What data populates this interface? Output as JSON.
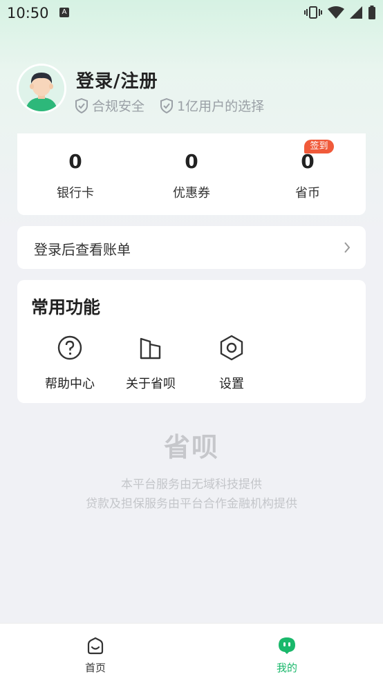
{
  "status_bar": {
    "time": "10:50",
    "notification_icon": "a-icon",
    "icons": [
      "vibrate-icon",
      "wifi-icon",
      "signal-icon",
      "battery-icon"
    ]
  },
  "profile": {
    "title": "登录/注册",
    "tags": [
      {
        "icon": "shield-check-icon",
        "label": "合规安全"
      },
      {
        "icon": "shield-check-icon",
        "label": "1亿用户的选择"
      }
    ]
  },
  "stats": [
    {
      "value": "0",
      "label": "银行卡"
    },
    {
      "value": "0",
      "label": "优惠券"
    },
    {
      "value": "0",
      "label": "省币",
      "badge": "签到"
    }
  ],
  "bill": {
    "label": "登录后查看账单"
  },
  "functions": {
    "title": "常用功能",
    "items": [
      {
        "icon": "help-icon",
        "label": "帮助中心"
      },
      {
        "icon": "building-icon",
        "label": "关于省呗"
      },
      {
        "icon": "settings-icon",
        "label": "设置"
      }
    ]
  },
  "footer": {
    "logo": "省呗",
    "line1": "本平台服务由无域科技提供",
    "line2": "贷款及担保服务由平台合作金融机构提供"
  },
  "tabbar": {
    "items": [
      {
        "label": "首页",
        "active": false
      },
      {
        "label": "我的",
        "active": true
      }
    ]
  },
  "colors": {
    "accent": "#1ab86b",
    "badge": "#f05a3a",
    "background": "#f0f1f5"
  }
}
